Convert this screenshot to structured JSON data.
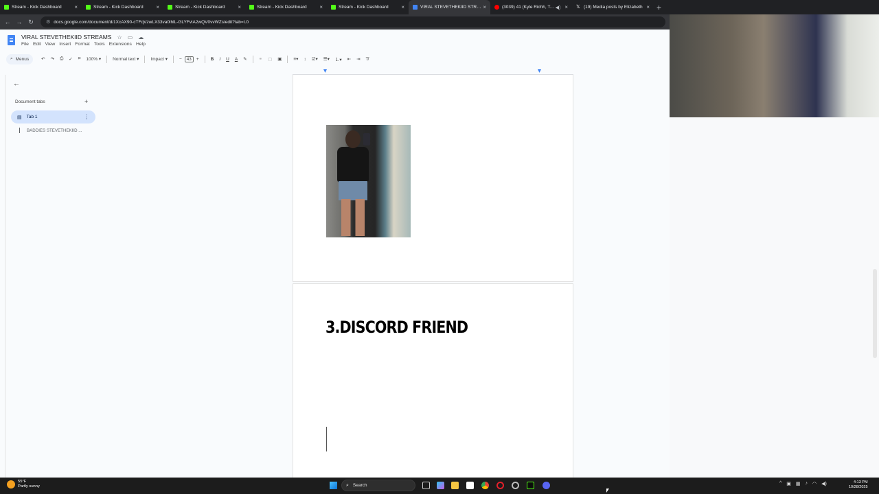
{
  "browser": {
    "tabs": [
      {
        "title": "Stream - Kick Dashboard",
        "favicon_color": "#53fc18",
        "active": false
      },
      {
        "title": "Stream - Kick Dashboard",
        "favicon_color": "#53fc18",
        "active": false
      },
      {
        "title": "Stream - Kick Dashboard",
        "favicon_color": "#53fc18",
        "active": false
      },
      {
        "title": "Stream - Kick Dashboard",
        "favicon_color": "#53fc18",
        "active": false
      },
      {
        "title": "Stream - Kick Dashboard",
        "favicon_color": "#53fc18",
        "active": false
      },
      {
        "title": "VIRAL STEVETHEKIID STREAMS",
        "favicon_color": "#4285f4",
        "active": true
      },
      {
        "title": "(3039) 41 (Kyle Richh, Tata",
        "favicon_color": "#ff0000",
        "active": false
      },
      {
        "title": "(19) Media posts by Elizabeth",
        "favicon_color": "#ffffff",
        "active": false
      }
    ],
    "new_tab_glyph": "+",
    "close_glyph": "×",
    "url": "docs.google.com/document/d/1XcAX90-cTFqVzwLX33va0lhlL-GLYFvlA2wQV0vvWZs/edit?tab=t.0"
  },
  "docs": {
    "title": "VIRAL STEVETHEKIID STREAMS",
    "menu": [
      "File",
      "Edit",
      "View",
      "Insert",
      "Format",
      "Tools",
      "Extensions",
      "Help"
    ],
    "toolbar": {
      "menus_label": "Menus",
      "zoom": "100%",
      "style": "Normal text",
      "font": "Impact",
      "font_size": "43"
    },
    "sidebar": {
      "header": "Document tabs",
      "tab_label": "Tab 1",
      "subtab_label": "BADDIES STEVETHEKIID ..."
    },
    "page2_heading": "3.DISCORD FRIEND"
  },
  "taskbar": {
    "weather_temp": "55°F",
    "weather_desc": "Partly sunny",
    "search_label": "Search",
    "time": "4:13 PM",
    "date": "10/28/2025"
  }
}
